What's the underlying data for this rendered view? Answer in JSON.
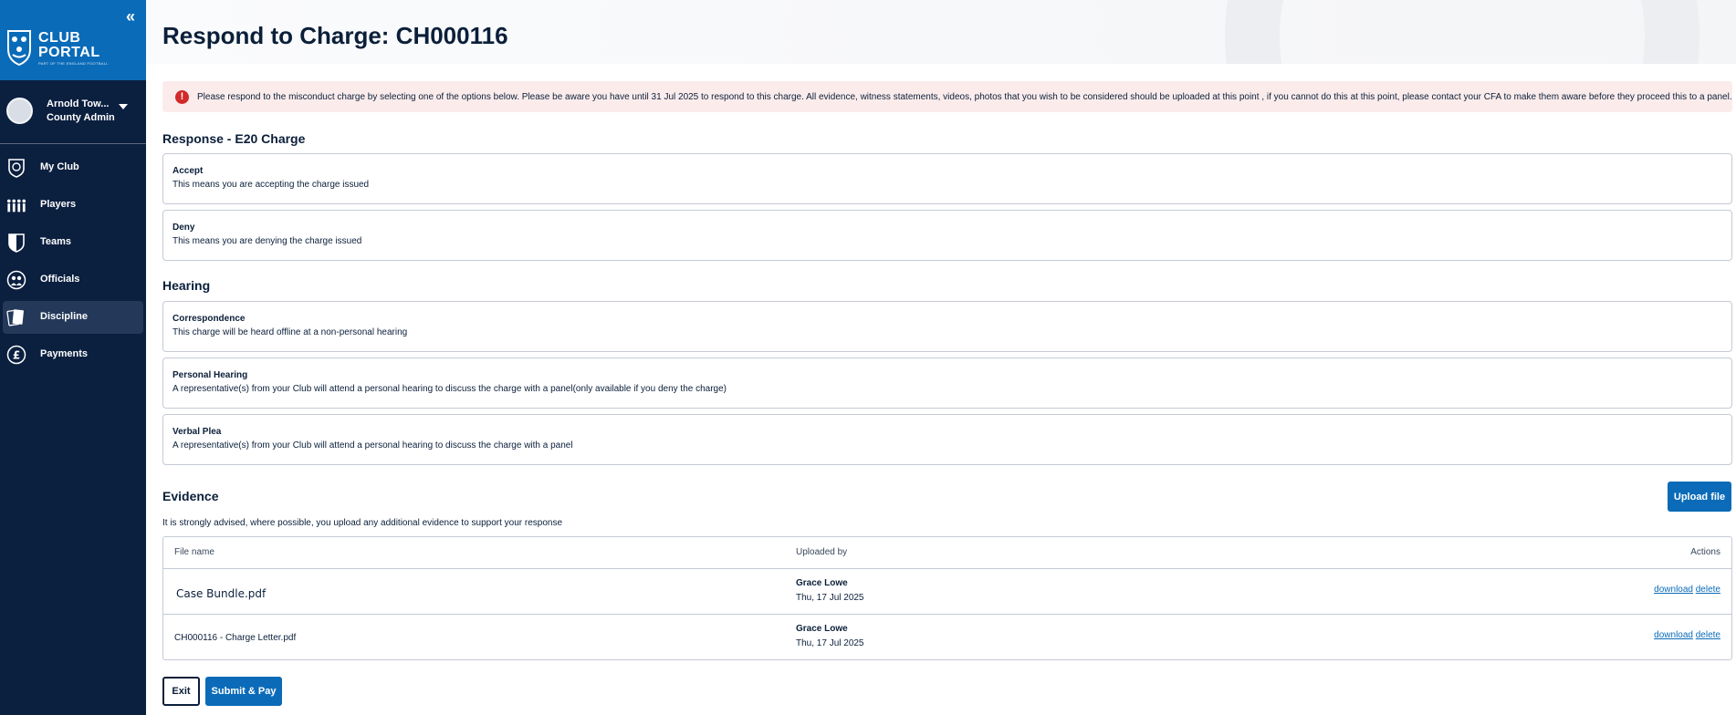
{
  "sidebar": {
    "brand": {
      "line1": "CLUB",
      "line2": "PORTAL",
      "subtitle": "PART OF THE ENGLAND FOOTBALL"
    },
    "user": {
      "name": "Arnold Tow...",
      "role": "County Admin"
    },
    "items": [
      {
        "label": "My Club",
        "icon": "club-crest-icon"
      },
      {
        "label": "Players",
        "icon": "players-icon"
      },
      {
        "label": "Teams",
        "icon": "shield-icon"
      },
      {
        "label": "Officials",
        "icon": "officials-icon"
      },
      {
        "label": "Discipline",
        "icon": "cards-icon",
        "active": true
      },
      {
        "label": "Payments",
        "icon": "pound-icon"
      }
    ]
  },
  "page": {
    "title": "Respond to Charge: CH000116",
    "alert": "Please respond to the misconduct charge by selecting one of the options below. Please be aware you have until 31 Jul 2025 to respond to this charge. All evidence, witness statements, videos, photos that you wish to be considered should be uploaded at this point , if you cannot do this at this point, please contact your CFA to make them aware before they proceed this to a panel."
  },
  "response": {
    "title": "Response - E20 Charge",
    "options": [
      {
        "title": "Accept",
        "desc": "This means you are accepting the charge issued"
      },
      {
        "title": "Deny",
        "desc": "This means you are denying the charge issued"
      }
    ]
  },
  "hearing": {
    "title": "Hearing",
    "options": [
      {
        "title": "Correspondence",
        "desc": "This charge will be heard offline at a non-personal hearing"
      },
      {
        "title": "Personal Hearing",
        "desc": "A representative(s) from your Club will attend a personal hearing to discuss the charge with a panel(only available if you deny the charge)"
      },
      {
        "title": "Verbal Plea",
        "desc": "A representative(s) from your Club will attend a personal hearing to discuss the charge with a panel"
      }
    ]
  },
  "evidence": {
    "title": "Evidence",
    "upload_label": "Upload file",
    "advice": "It is strongly advised, where possible, you upload any additional evidence to support your response",
    "columns": {
      "file": "File name",
      "uploaded_by": "Uploaded by",
      "actions": "Actions"
    },
    "rows": [
      {
        "file": "Case Bundle.pdf",
        "user": "Grace Lowe",
        "date": "Thu, 17 Jul 2025",
        "download": "download",
        "delete": "delete"
      },
      {
        "file": "CH000116 - Charge Letter.pdf",
        "user": "Grace Lowe",
        "date": "Thu, 17 Jul 2025",
        "download": "download",
        "delete": "delete"
      }
    ]
  },
  "footer": {
    "exit_label": "Exit",
    "submit_label": "Submit & Pay"
  }
}
